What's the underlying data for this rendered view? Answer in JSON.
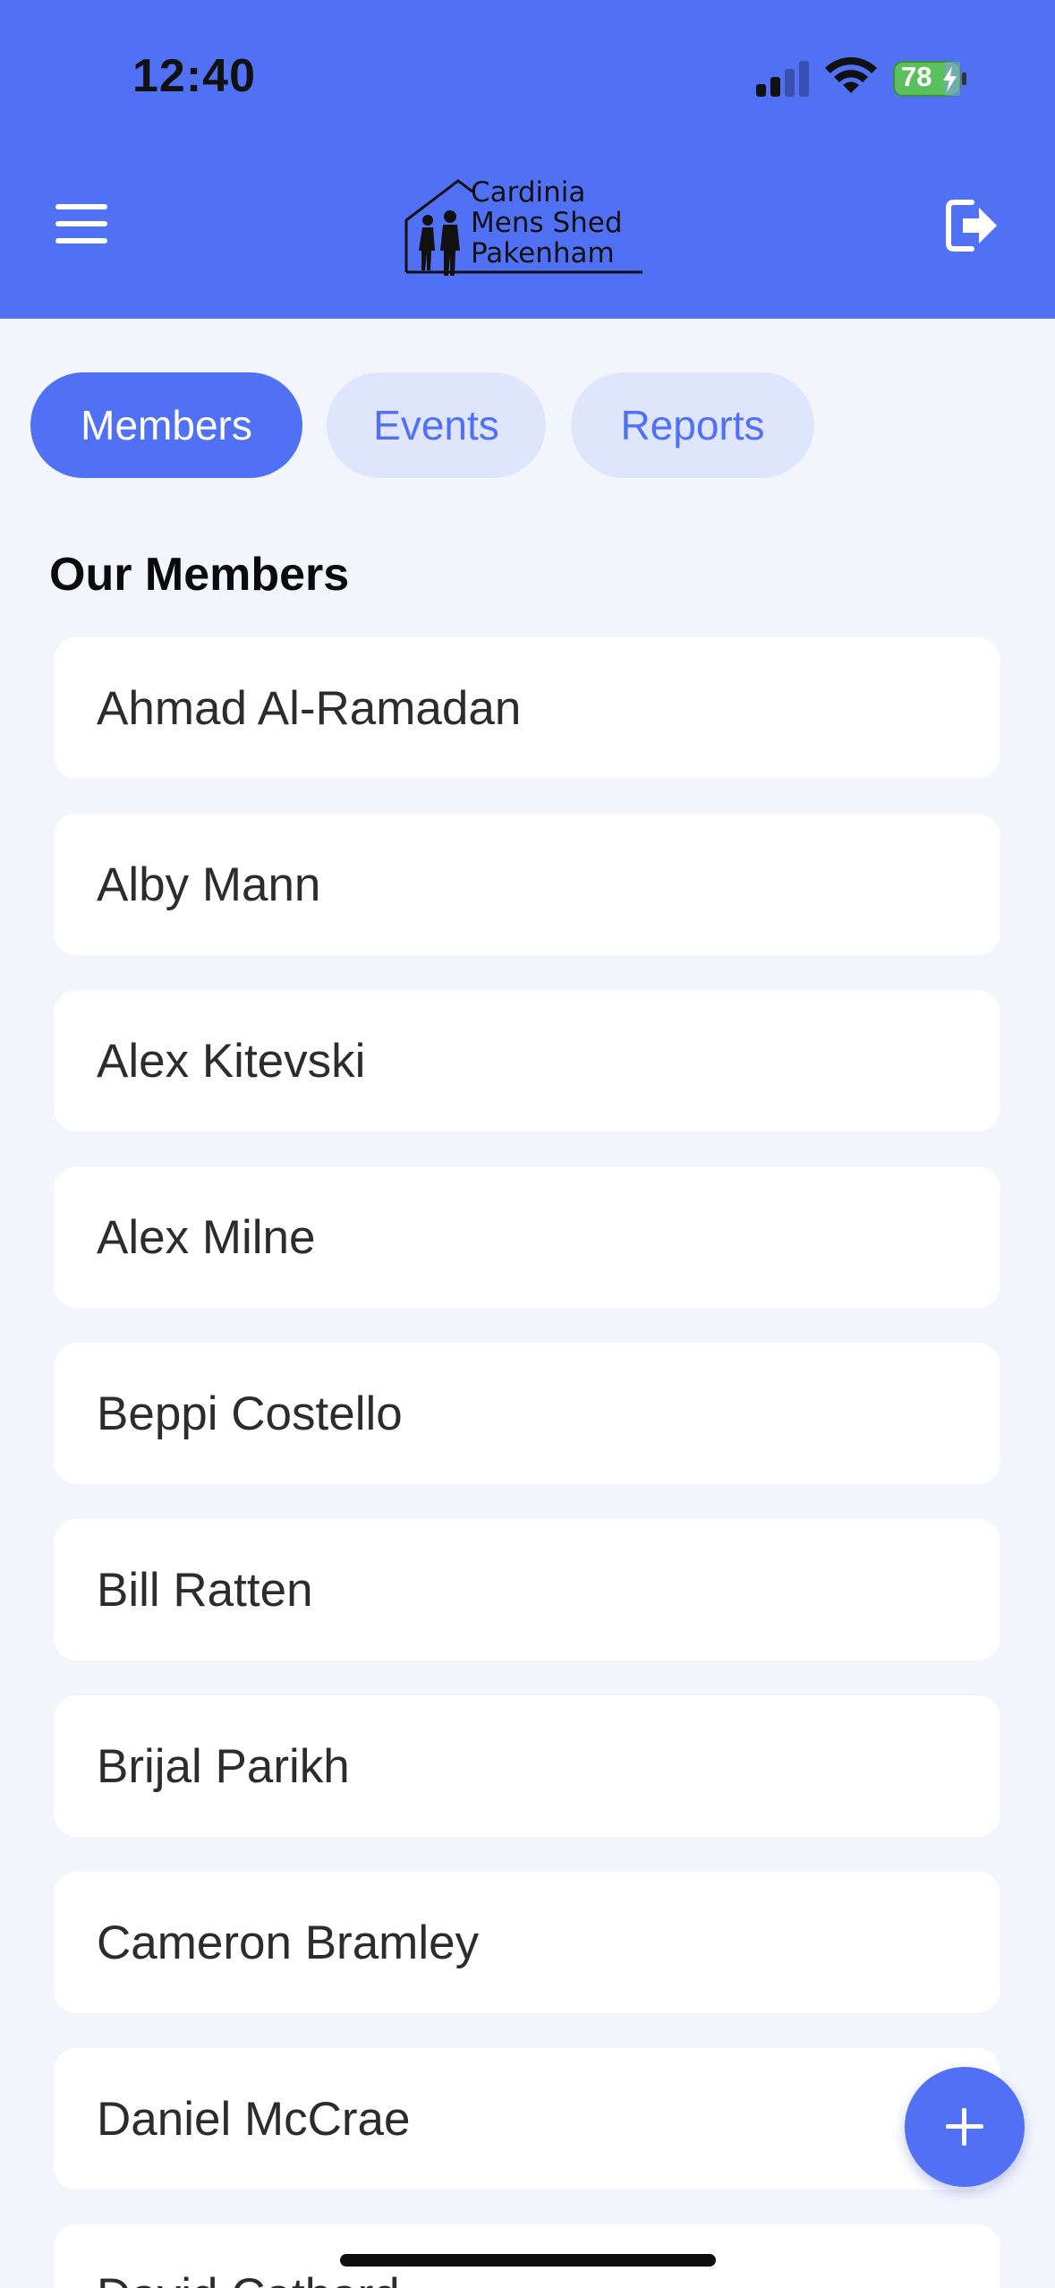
{
  "status_bar": {
    "time": "12:40",
    "battery": "78",
    "icons": [
      "signal-icon",
      "wifi-icon",
      "battery-charging-icon"
    ]
  },
  "header": {
    "menu_icon": "hamburger-menu-icon",
    "logo_lines": [
      "Cardinia",
      "Mens Shed",
      "Pakenham"
    ],
    "logout_icon": "logout-icon"
  },
  "tabs": [
    {
      "label": "Members",
      "active": true
    },
    {
      "label": "Events",
      "active": false
    },
    {
      "label": "Reports",
      "active": false
    }
  ],
  "section_title": "Our Members",
  "members": [
    "Ahmad Al-Ramadan",
    "Alby Mann",
    "Alex Kitevski",
    "Alex Milne",
    "Beppi Costello",
    "Bill Ratten",
    "Brijal Parikh",
    "Cameron Bramley",
    "Daniel McCrae",
    "David Cathard"
  ],
  "fab": {
    "icon": "plus-icon"
  },
  "colors": {
    "accent": "#5171f5",
    "tab_inactive_bg": "#dfe5fd",
    "page_bg": "#f3f5fd",
    "card_bg": "#ffffff"
  }
}
